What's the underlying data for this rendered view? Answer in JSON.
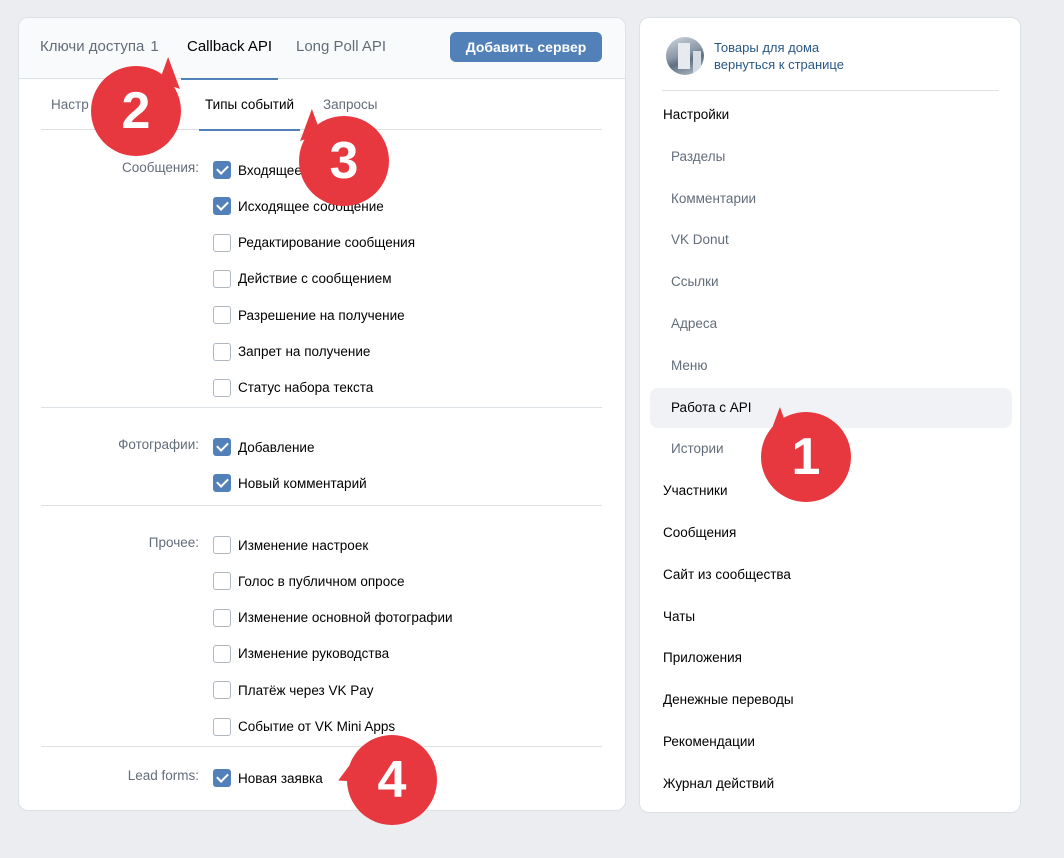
{
  "top_tabs": [
    {
      "label": "Ключи доступа",
      "count": "1"
    },
    {
      "label": "Callback API"
    },
    {
      "label": "Long Poll API"
    }
  ],
  "add_server_label": "Добавить сервер",
  "sub_tabs": [
    "Настр",
    "Типы событий",
    "Запросы"
  ],
  "sections": [
    {
      "label": "Сообщения:",
      "items": [
        {
          "label": "Входящее",
          "checked": true
        },
        {
          "label": "Исходящее сообщение",
          "checked": true
        },
        {
          "label": "Редактирование сообщения",
          "checked": false
        },
        {
          "label": "Действие с сообщением",
          "checked": false
        },
        {
          "label": "Разрешение на получение",
          "checked": false
        },
        {
          "label": "Запрет на получение",
          "checked": false
        },
        {
          "label": "Статус набора текста",
          "checked": false
        }
      ]
    },
    {
      "label": "Фотографии:",
      "items": [
        {
          "label": "Добавление",
          "checked": true
        },
        {
          "label": "Новый комментарий",
          "checked": true
        }
      ]
    },
    {
      "label": "Прочее:",
      "items": [
        {
          "label": "Изменение настроек",
          "checked": false
        },
        {
          "label": "Голос в публичном опросе",
          "checked": false
        },
        {
          "label": "Изменение основной фотографии",
          "checked": false
        },
        {
          "label": "Изменение руководства",
          "checked": false
        },
        {
          "label": "Платёж через VK Pay",
          "checked": false
        },
        {
          "label": "Событие от VK Mini Apps",
          "checked": false
        }
      ]
    },
    {
      "label": "Lead forms:",
      "items": [
        {
          "label": "Новая заявка",
          "checked": true
        }
      ]
    }
  ],
  "group": {
    "name": "Товары для дома",
    "back": "вернуться к странице"
  },
  "menu": [
    {
      "label": "Настройки",
      "sub": false
    },
    {
      "label": "Разделы",
      "sub": true
    },
    {
      "label": "Комментарии",
      "sub": true
    },
    {
      "label": "VK Donut",
      "sub": true
    },
    {
      "label": "Ссылки",
      "sub": true
    },
    {
      "label": "Адреса",
      "sub": true
    },
    {
      "label": "Меню",
      "sub": true
    },
    {
      "label": "Работа с API",
      "sub": true,
      "selected": true
    },
    {
      "label": "Истории",
      "sub": true
    },
    {
      "label": "Участники",
      "sub": false
    },
    {
      "label": "Сообщения",
      "sub": false
    },
    {
      "label": "Сайт из сообщества",
      "sub": false
    },
    {
      "label": "Чаты",
      "sub": false
    },
    {
      "label": "Приложения",
      "sub": false
    },
    {
      "label": "Денежные переводы",
      "sub": false
    },
    {
      "label": "Рекомендации",
      "sub": false
    },
    {
      "label": "Журнал действий",
      "sub": false
    }
  ],
  "markers": [
    "1",
    "2",
    "3",
    "4"
  ],
  "colors": {
    "accent": "#5181b8",
    "marker": "#e7373f",
    "link": "#2a5885"
  }
}
